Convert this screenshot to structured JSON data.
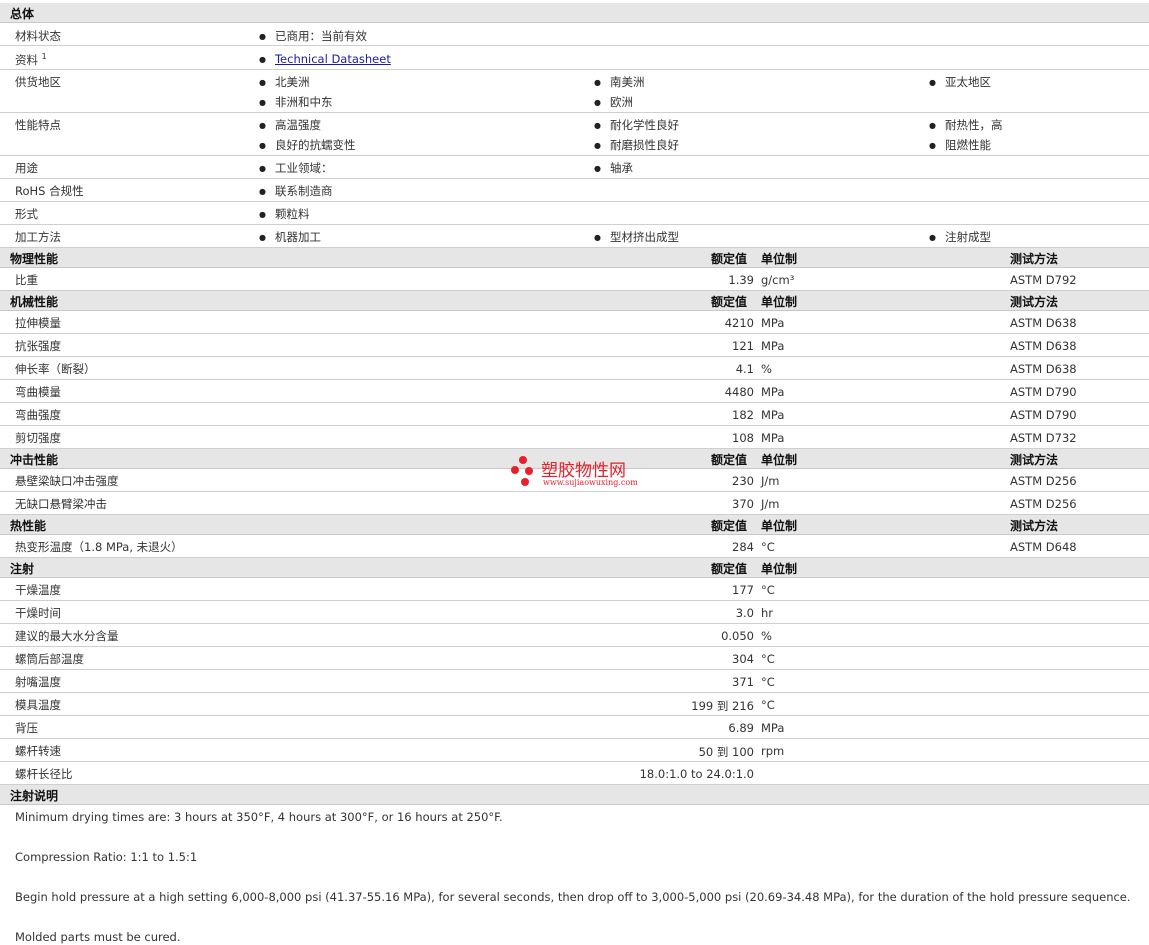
{
  "general": {
    "title": "总体",
    "material_status": {
      "label": "材料状态",
      "value": "已商用：当前有效"
    },
    "docs": {
      "label": "资料",
      "sup": "1",
      "link": "Technical Datasheet"
    },
    "regions": {
      "label": "供货地区",
      "items": [
        "北美洲",
        "南美洲",
        "亚太地区",
        "非洲和中东",
        "欧洲"
      ]
    },
    "features": {
      "label": "性能特点",
      "items": [
        "高温强度",
        "耐化学性良好",
        "耐热性，高",
        "良好的抗蠕变性",
        "耐磨损性良好",
        "阻燃性能"
      ]
    },
    "uses": {
      "label": "用途",
      "items": [
        "工业领域：",
        "轴承"
      ]
    },
    "rohs": {
      "label": "RoHS 合规性",
      "value": "联系制造商"
    },
    "form": {
      "label": "形式",
      "value": "颗粒料"
    },
    "processing": {
      "label": "加工方法",
      "items": [
        "机器加工",
        "型材挤出成型",
        "注射成型"
      ]
    }
  },
  "columns": {
    "nominal": "额定值",
    "unit": "单位制",
    "method": "测试方法"
  },
  "physical": {
    "title": "物理性能",
    "rows": [
      {
        "label": "比重",
        "value": "1.39",
        "unit": "g/cm³",
        "method": "ASTM D792"
      }
    ]
  },
  "mechanical": {
    "title": "机械性能",
    "rows": [
      {
        "label": "拉伸模量",
        "value": "4210",
        "unit": "MPa",
        "method": "ASTM D638"
      },
      {
        "label": "抗张强度",
        "value": "121",
        "unit": "MPa",
        "method": "ASTM D638"
      },
      {
        "label": "伸长率（断裂）",
        "value": "4.1",
        "unit": "%",
        "method": "ASTM D638"
      },
      {
        "label": "弯曲模量",
        "value": "4480",
        "unit": "MPa",
        "method": "ASTM D790"
      },
      {
        "label": "弯曲强度",
        "value": "182",
        "unit": "MPa",
        "method": "ASTM D790"
      },
      {
        "label": "剪切强度",
        "value": "108",
        "unit": "MPa",
        "method": "ASTM D732"
      }
    ]
  },
  "impact": {
    "title": "冲击性能",
    "rows": [
      {
        "label": "悬壁梁缺口冲击强度",
        "value": "230",
        "unit": "J/m",
        "method": "ASTM D256"
      },
      {
        "label": "无缺口悬臂梁冲击",
        "value": "370",
        "unit": "J/m",
        "method": "ASTM D256"
      }
    ]
  },
  "thermal": {
    "title": "热性能",
    "rows": [
      {
        "label": "热变形温度（1.8 MPa, 未退火）",
        "value": "284",
        "unit": "°C",
        "method": "ASTM D648"
      }
    ]
  },
  "injection": {
    "title": "注射",
    "rows": [
      {
        "label": "干燥温度",
        "value": "177",
        "unit": "°C"
      },
      {
        "label": "干燥时间",
        "value": "3.0",
        "unit": "hr"
      },
      {
        "label": "建议的最大水分含量",
        "value": "0.050",
        "unit": "%"
      },
      {
        "label": "螺筒后部温度",
        "value": "304",
        "unit": "°C"
      },
      {
        "label": "射嘴温度",
        "value": "371",
        "unit": "°C"
      },
      {
        "label": "模具温度",
        "value": "199 到 216",
        "unit": "°C"
      },
      {
        "label": "背压",
        "value": "6.89",
        "unit": "MPa"
      },
      {
        "label": "螺杆转速",
        "value": "50 到 100",
        "unit": "rpm"
      },
      {
        "label": "螺杆长径比",
        "value": "18.0:1.0 to 24.0:1.0",
        "unit": ""
      }
    ]
  },
  "notes": {
    "title": "注射说明",
    "lines": [
      "Minimum drying times are: 3 hours at 350°F, 4 hours at 300°F, or 16 hours at 250°F.",
      "Compression Ratio: 1:1 to 1.5:1",
      "Begin hold pressure at a high setting 6,000-8,000 psi (41.37-55.16 MPa), for several seconds, then drop off to 3,000-5,000 psi (20.69-34.48 MPa), for the duration of the hold pressure sequence.",
      "Molded parts must be cured."
    ]
  },
  "watermark": {
    "text": "塑胶物性网",
    "sub": "www.sujiaowuxing.com",
    "color": "#e8202a"
  }
}
